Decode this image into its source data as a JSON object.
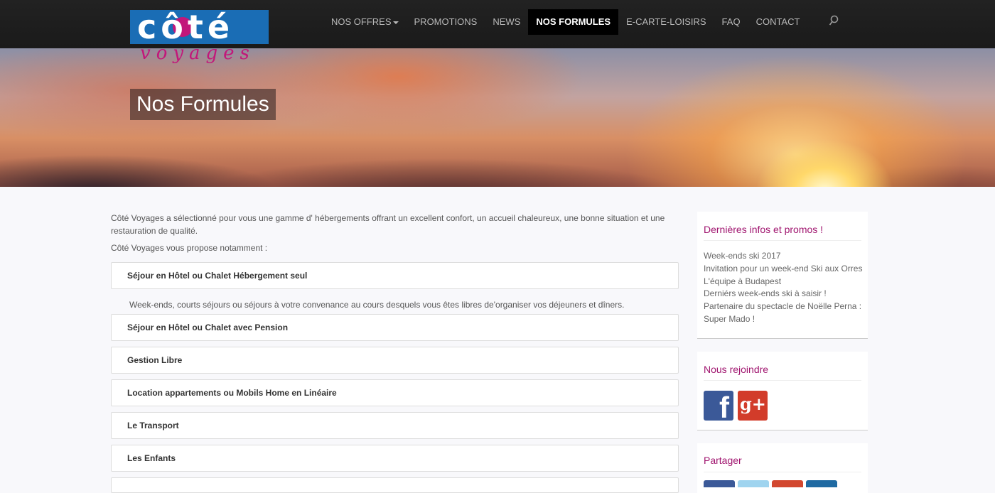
{
  "logo": {
    "word": "côté",
    "sub": "voyages"
  },
  "nav": {
    "items": [
      {
        "label": "NOS OFFRES",
        "dropdown": true
      },
      {
        "label": "PROMOTIONS"
      },
      {
        "label": "NEWS"
      },
      {
        "label": "NOS FORMULES",
        "active": true
      },
      {
        "label": "E-CARTE-LOISIRS"
      },
      {
        "label": "FAQ"
      },
      {
        "label": "CONTACT"
      }
    ],
    "search_icon": "search-icon"
  },
  "hero": {
    "title": "Nos Formules"
  },
  "main": {
    "intro": "Côté Voyages a sélectionné pour vous une gamme d' hébergements offrant un excellent confort, un accueil chaleureux, une bonne situation et une restauration de qualité.",
    "intro2": "Côté Voyages vous propose notamment :",
    "panels": [
      {
        "title": "Séjour en Hôtel ou Chalet Hébergement seul",
        "body": "Week-ends, courts séjours ou séjours à votre convenance au cours desquels vous êtes libres de'organiser vos déjeuners et dîners."
      },
      {
        "title": "Séjour en Hôtel ou Chalet avec Pension"
      },
      {
        "title": "Gestion Libre"
      },
      {
        "title": "Location appartements ou Mobils Home en Linéaire"
      },
      {
        "title": "Le Transport"
      },
      {
        "title": "Les Enfants"
      }
    ]
  },
  "sidebar": {
    "news": {
      "title": "Dernières infos et promos !",
      "items": [
        "Week-ends ski 2017",
        "Invitation pour un week-end Ski aux Orres",
        "L'équipe à Budapest",
        "Derniérs week-ends ski à saisir !",
        "Partenaire du spectacle de Noëlle Perna :",
        "Super Mado !"
      ]
    },
    "join": {
      "title": "Nous rejoindre",
      "facebook_glyph": "f",
      "gplus_glyph": "g+"
    },
    "share": {
      "title": "Partager"
    }
  },
  "colors": {
    "accent": "#a0156f",
    "logo_blue": "#1a6db5",
    "logo_pink": "#c2177a",
    "facebook": "#3b5998",
    "gplus": "#d23c2a"
  }
}
